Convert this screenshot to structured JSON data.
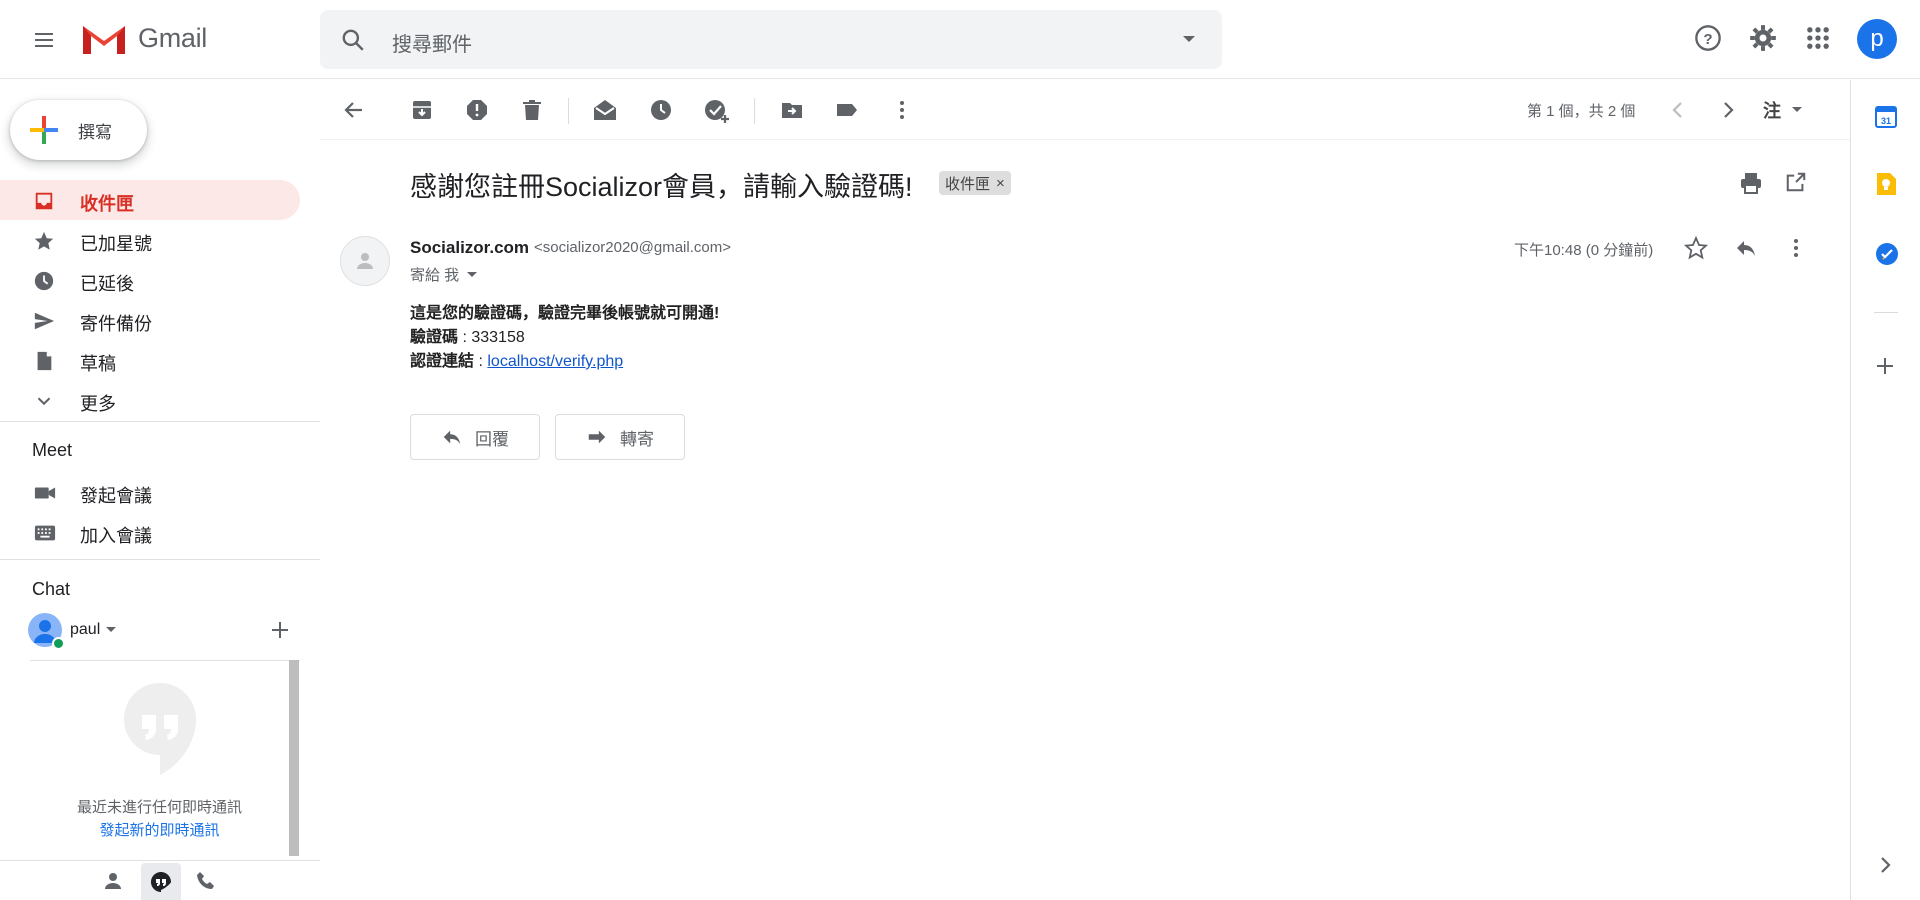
{
  "app": {
    "name": "Gmail"
  },
  "search": {
    "placeholder": "搜尋郵件"
  },
  "header": {
    "avatar_letter": "p"
  },
  "compose": {
    "label": "撰寫"
  },
  "nav": {
    "items": [
      {
        "label": "收件匣",
        "icon": "inbox-icon",
        "active": true
      },
      {
        "label": "已加星號",
        "icon": "star-icon"
      },
      {
        "label": "已延後",
        "icon": "clock-icon"
      },
      {
        "label": "寄件備份",
        "icon": "send-icon"
      },
      {
        "label": "草稿",
        "icon": "draft-icon"
      },
      {
        "label": "更多",
        "icon": "chevron-down-icon"
      }
    ]
  },
  "meet": {
    "title": "Meet",
    "items": [
      {
        "label": "發起會議",
        "icon": "video-icon"
      },
      {
        "label": "加入會議",
        "icon": "keyboard-icon"
      }
    ]
  },
  "chat": {
    "title": "Chat",
    "user": "paul",
    "empty_text": "最近未進行任何即時通訊",
    "start_link": "發起新的即時通訊"
  },
  "toolbar": {
    "pager": "第 1 個，共 2 個",
    "lang": "注"
  },
  "message": {
    "subject": "感謝您註冊Socializor會員，請輸入驗證碼!",
    "label": "收件匣",
    "sender_name": "Socializor.com",
    "sender_email": "<socializor2020@gmail.com>",
    "to": "寄給 我",
    "time": "下午10:48 (0 分鐘前)",
    "body": {
      "line1": "這是您的驗證碼，驗證完畢後帳號就可開通!",
      "code_label": "驗證碼",
      "code_sep": " : ",
      "code_value": "333158",
      "link_label": "認證連結",
      "link_sep": " : ",
      "link_text": "localhost/verify.php"
    },
    "reply_label": "回覆",
    "forward_label": "轉寄"
  },
  "colors": {
    "accent_red": "#d93025",
    "active_bg": "#fce8e6",
    "link_blue": "#1155cc",
    "avatar_blue": "#1a73e8"
  }
}
